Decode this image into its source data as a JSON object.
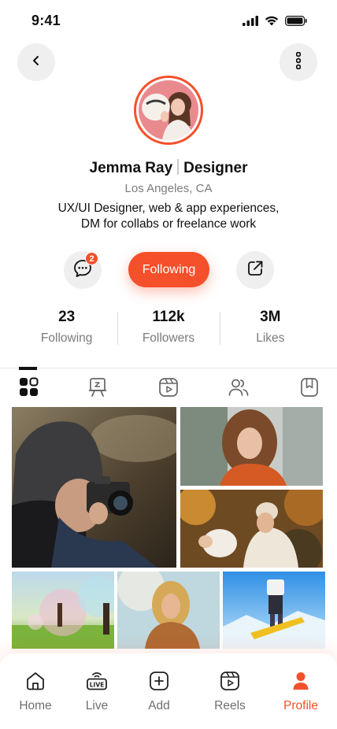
{
  "status_bar": {
    "time": "9:41"
  },
  "profile": {
    "name": "Jemma Ray",
    "role": "Designer",
    "location": "Los Angeles, CA",
    "bio_line1": "UX/UI Designer, web & app experiences,",
    "bio_line2": "DM for collabs or freelance work"
  },
  "actions": {
    "message_badge": "2",
    "follow_label": "Following"
  },
  "stats": [
    {
      "value": "23",
      "label": "Following"
    },
    {
      "value": "112k",
      "label": "Followers"
    },
    {
      "value": "3M",
      "label": "Likes"
    }
  ],
  "tabs": [
    "grid-icon",
    "easel-icon",
    "reels-icon",
    "people-icon",
    "bookmark-icon"
  ],
  "active_tab": 0,
  "nav": [
    {
      "label": "Home",
      "icon": "home-icon"
    },
    {
      "label": "Live",
      "icon": "live-icon"
    },
    {
      "label": "Add",
      "icon": "add-icon"
    },
    {
      "label": "Reels",
      "icon": "reels-icon"
    },
    {
      "label": "Profile",
      "icon": "profile-icon"
    }
  ],
  "active_nav": 4,
  "colors": {
    "accent": "#f4502b",
    "muted": "#7b7b7b",
    "button_bg": "#efefef"
  }
}
